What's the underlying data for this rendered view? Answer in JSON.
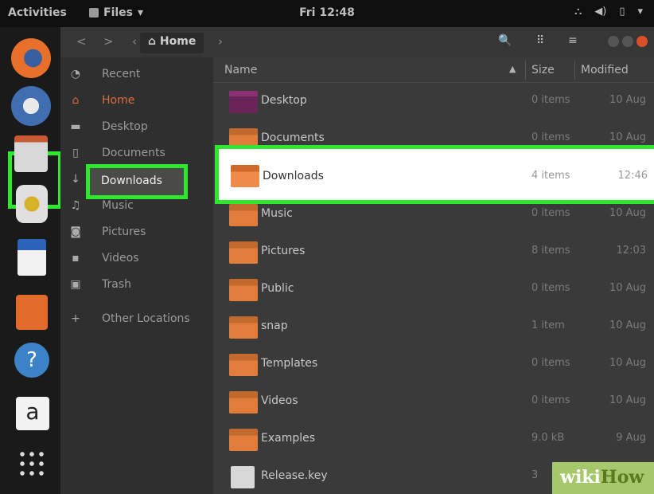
{
  "topbar": {
    "activities": "Activities",
    "app_menu": "Files",
    "app_menu_caret": "▾",
    "clock": "Fri 12:48",
    "tray_icons": [
      "network-icon",
      "volume-icon",
      "battery-icon",
      "menu-caret-icon"
    ]
  },
  "dock": {
    "apps": [
      "firefox-icon",
      "thunderbird-icon",
      "files-icon",
      "rhythmbox-icon",
      "writer-icon",
      "software-center-icon",
      "help-icon",
      "amazon-icon",
      "show-apps-icon"
    ],
    "amazon_glyph": "a",
    "help_glyph": "?"
  },
  "header": {
    "back": "<",
    "forward": ">",
    "breadcrumb_label": "Home",
    "search_glyph": "🔍",
    "view_glyph": "⠿",
    "menu_glyph": "≡"
  },
  "sidebar": {
    "items": [
      {
        "icon": "recent-icon",
        "glyph": "◔",
        "label": "Recent"
      },
      {
        "icon": "home-icon",
        "glyph": "⌂",
        "label": "Home"
      },
      {
        "icon": "desktop-icon",
        "glyph": "▬",
        "label": "Desktop"
      },
      {
        "icon": "documents-icon",
        "glyph": "▯",
        "label": "Documents"
      },
      {
        "icon": "downloads-icon",
        "glyph": "↓",
        "label": "Downloads"
      },
      {
        "icon": "music-icon",
        "glyph": "♫",
        "label": "Music"
      },
      {
        "icon": "pictures-icon",
        "glyph": "◙",
        "label": "Pictures"
      },
      {
        "icon": "videos-icon",
        "glyph": "▪",
        "label": "Videos"
      },
      {
        "icon": "trash-icon",
        "glyph": "▣",
        "label": "Trash"
      },
      {
        "icon": "add-icon",
        "glyph": "+",
        "label": "Other Locations"
      }
    ]
  },
  "list": {
    "columns": {
      "name": "Name",
      "sort_glyph": "▲",
      "size": "Size",
      "modified": "Modified"
    },
    "rows": [
      {
        "name": "Desktop",
        "size": "0 items",
        "modified": "10 Aug"
      },
      {
        "name": "Documents",
        "size": "0 items",
        "modified": "10 Aug"
      },
      {
        "name": "Downloads",
        "size": "4 items",
        "modified": "12:46"
      },
      {
        "name": "Music",
        "size": "0 items",
        "modified": "10 Aug"
      },
      {
        "name": "Pictures",
        "size": "8 items",
        "modified": "12:03"
      },
      {
        "name": "Public",
        "size": "0 items",
        "modified": "10 Aug"
      },
      {
        "name": "snap",
        "size": "1 item",
        "modified": "10 Aug"
      },
      {
        "name": "Templates",
        "size": "0 items",
        "modified": "10 Aug"
      },
      {
        "name": "Videos",
        "size": "0 items",
        "modified": "10 Aug"
      },
      {
        "name": "Examples",
        "size": "9.0 kB",
        "modified": "9 Aug"
      },
      {
        "name": "Release.key",
        "size": "3",
        "modified": ""
      }
    ]
  },
  "watermark": {
    "wiki": "wiki",
    "how": "How"
  }
}
